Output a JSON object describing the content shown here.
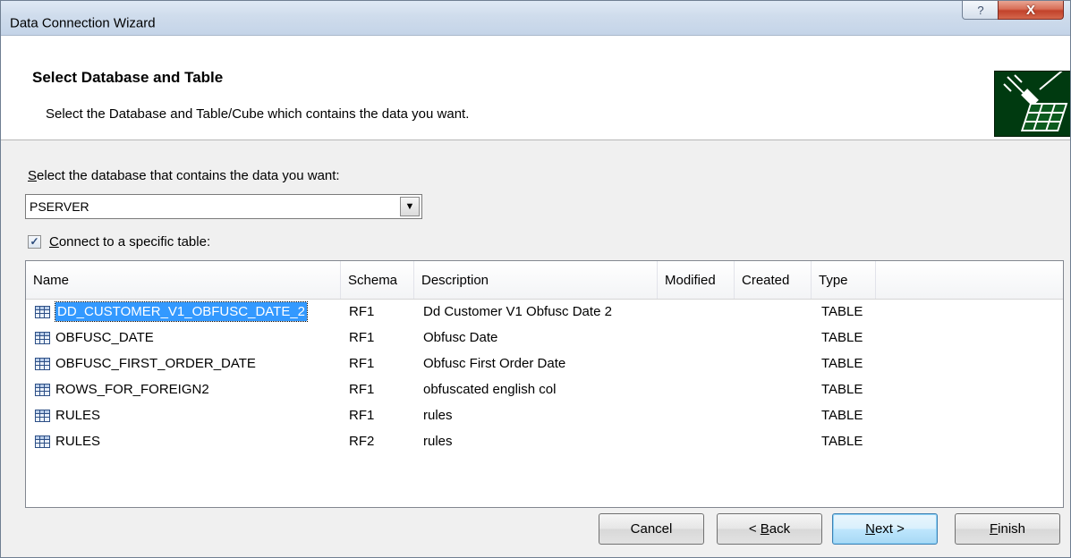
{
  "window": {
    "title": "Data Connection Wizard",
    "help_glyph": "?",
    "close_glyph": "X"
  },
  "header": {
    "title": "Select Database and Table",
    "subtitle": "Select the Database and Table/Cube which contains the data you want."
  },
  "database": {
    "label_accel": "S",
    "label_rest": "elect the database that contains the data you want:",
    "selected": "PSERVER",
    "arrow_glyph": "▼"
  },
  "specific_table": {
    "checked": true,
    "check_glyph": "✓",
    "label_accel": "C",
    "label_rest": "onnect to a specific table:"
  },
  "table": {
    "columns": [
      "Name",
      "Schema",
      "Description",
      "Modified",
      "Created",
      "Type"
    ],
    "rows": [
      {
        "name": "DD_CUSTOMER_V1_OBFUSC_DATE_2",
        "schema": "RF1",
        "description": "Dd Customer V1 Obfusc Date 2",
        "modified": "",
        "created": "",
        "type": "TABLE"
      },
      {
        "name": "OBFUSC_DATE",
        "schema": "RF1",
        "description": "Obfusc Date",
        "modified": "",
        "created": "",
        "type": "TABLE"
      },
      {
        "name": "OBFUSC_FIRST_ORDER_DATE",
        "schema": "RF1",
        "description": "Obfusc First Order Date",
        "modified": "",
        "created": "",
        "type": "TABLE"
      },
      {
        "name": "ROWS_FOR_FOREIGN2",
        "schema": "RF1",
        "description": "obfuscated english col",
        "modified": "",
        "created": "",
        "type": "TABLE"
      },
      {
        "name": "RULES",
        "schema": "RF1",
        "description": "rules",
        "modified": "",
        "created": "",
        "type": "TABLE"
      },
      {
        "name": "RULES",
        "schema": "RF2",
        "description": "rules",
        "modified": "",
        "created": "",
        "type": "TABLE"
      }
    ],
    "selected_row": 0
  },
  "buttons": {
    "cancel": "Cancel",
    "back_pre": "< ",
    "back_accel": "B",
    "back_rest": "ack",
    "next_accel": "N",
    "next_rest": "ext >",
    "finish_accel": "F",
    "finish_rest": "inish"
  },
  "icons": {
    "header_icon": "plug-table-icon",
    "table_row_icon": "table-icon"
  },
  "colors": {
    "selection": "#3399ff",
    "header_icon_bg": "#003a10",
    "close_button": "#c2422a"
  }
}
